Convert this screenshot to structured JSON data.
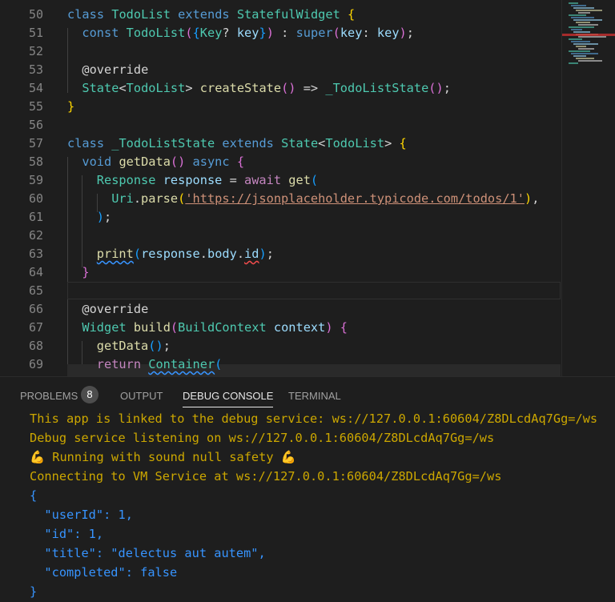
{
  "colors": {
    "keyword": "#569cd6",
    "type": "#4ec9b0",
    "function": "#dcdcaa",
    "variable": "#9cdcfe",
    "string": "#ce9178",
    "control": "#c586c0",
    "console_info": "#cca700",
    "console_json": "#3794ff"
  },
  "editor": {
    "lines": [
      {
        "n": "50",
        "indent": 0,
        "tokens": [
          [
            "class ",
            "k"
          ],
          [
            "TodoList ",
            "t"
          ],
          [
            "extends ",
            "k"
          ],
          [
            "StatefulWidget ",
            "t"
          ],
          [
            "{",
            "b1"
          ]
        ]
      },
      {
        "n": "51",
        "indent": 2,
        "tokens": [
          [
            "const ",
            "k"
          ],
          [
            "TodoList",
            "t"
          ],
          [
            "(",
            "b2"
          ],
          [
            "{",
            "b3"
          ],
          [
            "Key",
            "t"
          ],
          [
            "? ",
            "p"
          ],
          [
            "key",
            "v"
          ],
          [
            "}",
            "b3"
          ],
          [
            ")",
            "b2"
          ],
          [
            " : ",
            "p"
          ],
          [
            "super",
            "k"
          ],
          [
            "(",
            "b2"
          ],
          [
            "key",
            "v"
          ],
          [
            ": ",
            "p"
          ],
          [
            "key",
            "v"
          ],
          [
            ")",
            "b2"
          ],
          [
            ";",
            "p"
          ]
        ]
      },
      {
        "n": "52",
        "indent": 0,
        "tokens": []
      },
      {
        "n": "53",
        "indent": 2,
        "tokens": [
          [
            "@override",
            "a"
          ]
        ]
      },
      {
        "n": "54",
        "indent": 2,
        "tokens": [
          [
            "State",
            "t"
          ],
          [
            "<",
            "p"
          ],
          [
            "TodoList",
            "t"
          ],
          [
            "> ",
            "p"
          ],
          [
            "createState",
            "f"
          ],
          [
            "()",
            "b2"
          ],
          [
            " => ",
            "p"
          ],
          [
            "_TodoListState",
            "t"
          ],
          [
            "()",
            "b2"
          ],
          [
            ";",
            "p"
          ]
        ]
      },
      {
        "n": "55",
        "indent": 0,
        "tokens": [
          [
            "}",
            "b1"
          ]
        ]
      },
      {
        "n": "56",
        "indent": 0,
        "tokens": []
      },
      {
        "n": "57",
        "indent": 0,
        "tokens": [
          [
            "class ",
            "k"
          ],
          [
            "_TodoListState ",
            "t"
          ],
          [
            "extends ",
            "k"
          ],
          [
            "State",
            "t"
          ],
          [
            "<",
            "p"
          ],
          [
            "TodoList",
            "t"
          ],
          [
            "> ",
            "p"
          ],
          [
            "{",
            "b1"
          ]
        ]
      },
      {
        "n": "58",
        "indent": 2,
        "tokens": [
          [
            "void ",
            "k"
          ],
          [
            "getData",
            "f"
          ],
          [
            "()",
            "b2"
          ],
          [
            " async ",
            "k"
          ],
          [
            "{",
            "b2"
          ]
        ]
      },
      {
        "n": "59",
        "indent": 4,
        "tokens": [
          [
            "Response ",
            "t"
          ],
          [
            "response",
            "v"
          ],
          [
            " = ",
            "p"
          ],
          [
            "await ",
            "c"
          ],
          [
            "get",
            "f"
          ],
          [
            "(",
            "b3"
          ]
        ]
      },
      {
        "n": "60",
        "indent": 6,
        "tokens": [
          [
            "Uri",
            "t"
          ],
          [
            ".",
            "p"
          ],
          [
            "parse",
            "f"
          ],
          [
            "(",
            "b1"
          ],
          [
            "'https://jsonplaceholder.typicode.com/todos/1'",
            "s link"
          ],
          [
            ")",
            "b1"
          ],
          [
            ",",
            "p"
          ]
        ]
      },
      {
        "n": "61",
        "indent": 4,
        "tokens": [
          [
            ")",
            "b3"
          ],
          [
            ";",
            "p"
          ]
        ]
      },
      {
        "n": "62",
        "indent": 0,
        "tokens": []
      },
      {
        "n": "63",
        "indent": 4,
        "tokens": [
          [
            "print",
            "f sq-blue"
          ],
          [
            "(",
            "b3"
          ],
          [
            "response",
            "v"
          ],
          [
            ".",
            "p"
          ],
          [
            "body",
            "v"
          ],
          [
            ".",
            "p"
          ],
          [
            "id",
            "v sq-red"
          ],
          [
            ")",
            "b3"
          ],
          [
            ";",
            "p"
          ]
        ]
      },
      {
        "n": "64",
        "indent": 2,
        "tokens": [
          [
            "}",
            "b2"
          ]
        ]
      },
      {
        "n": "65",
        "indent": 0,
        "tokens": []
      },
      {
        "n": "66",
        "indent": 2,
        "tokens": [
          [
            "@override",
            "a"
          ]
        ]
      },
      {
        "n": "67",
        "indent": 2,
        "tokens": [
          [
            "Widget ",
            "t"
          ],
          [
            "build",
            "f"
          ],
          [
            "(",
            "b2"
          ],
          [
            "BuildContext ",
            "t"
          ],
          [
            "context",
            "v"
          ],
          [
            ")",
            "b2"
          ],
          [
            " {",
            "b2"
          ]
        ]
      },
      {
        "n": "68",
        "indent": 4,
        "tokens": [
          [
            "getData",
            "f"
          ],
          [
            "()",
            "b3"
          ],
          [
            ";",
            "p"
          ]
        ]
      },
      {
        "n": "69",
        "indent": 4,
        "tokens": [
          [
            "return ",
            "c"
          ],
          [
            "Container",
            "t sq-blue"
          ],
          [
            "(",
            "b3"
          ]
        ]
      }
    ]
  },
  "panel": {
    "tabs": [
      {
        "label": "PROBLEMS",
        "badge": "8"
      },
      {
        "label": "OUTPUT"
      },
      {
        "label": "DEBUG CONSOLE",
        "active": true
      },
      {
        "label": "TERMINAL"
      }
    ],
    "console": [
      {
        "text": "This app is linked to the debug service: ws://127.0.0.1:60604/Z8DLcdAq7Gg=/ws",
        "kind": "y"
      },
      {
        "text": "Debug service listening on ws://127.0.0.1:60604/Z8DLcdAq7Gg=/ws",
        "kind": "y"
      },
      {
        "text": "💪 Running with sound null safety 💪",
        "kind": "y"
      },
      {
        "text": "Connecting to VM Service at ws://127.0.0.1:60604/Z8DLcdAq7Gg=/ws",
        "kind": "y"
      },
      {
        "text": "{",
        "kind": "j"
      },
      {
        "text": "  \"userId\": 1,",
        "kind": "j"
      },
      {
        "text": "  \"id\": 1,",
        "kind": "j"
      },
      {
        "text": "  \"title\": \"delectus aut autem\",",
        "kind": "j"
      },
      {
        "text": "  \"completed\": false",
        "kind": "j"
      },
      {
        "text": "}",
        "kind": "j"
      }
    ]
  }
}
